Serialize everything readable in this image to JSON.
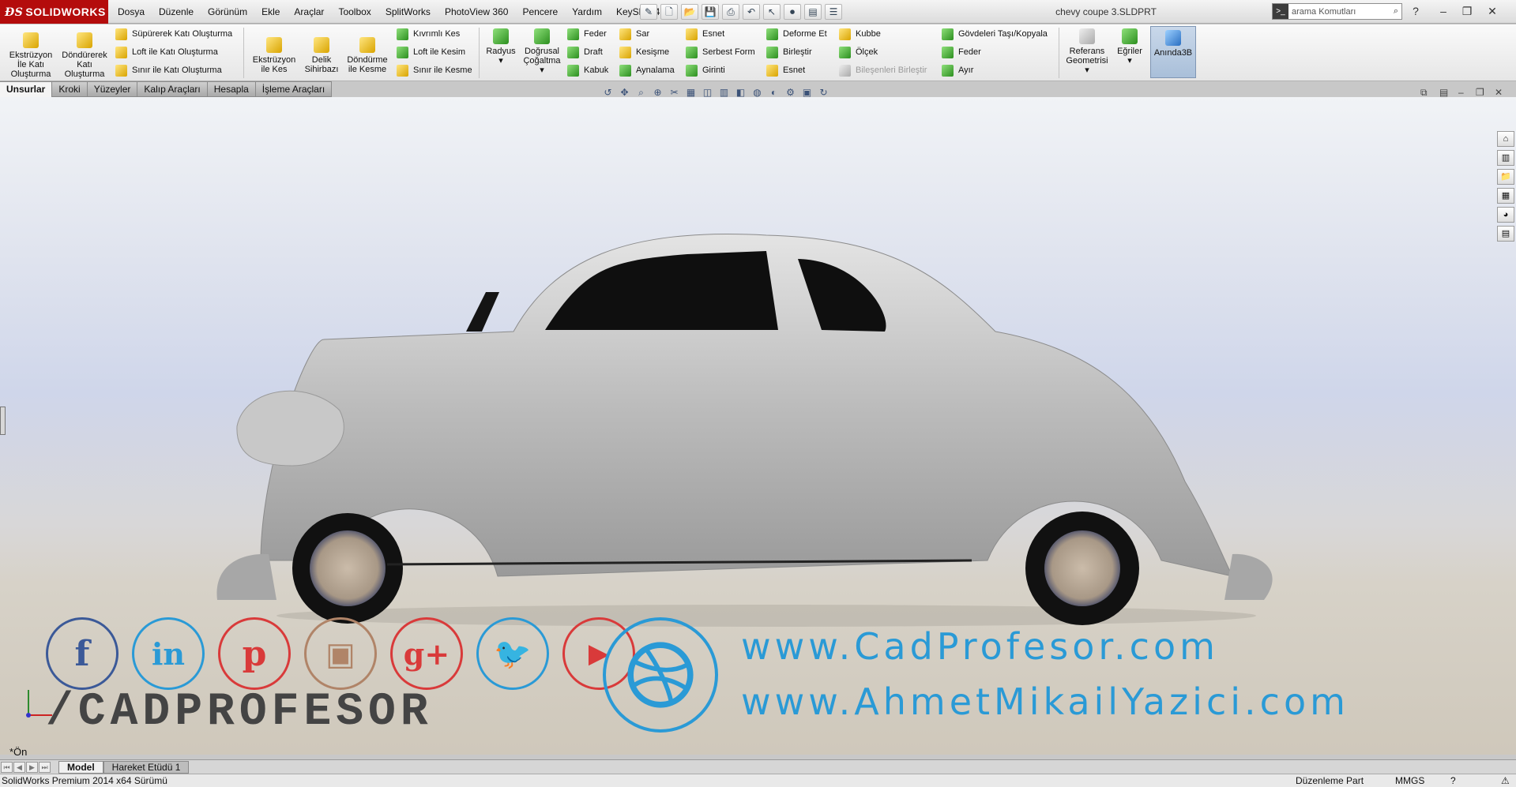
{
  "app": {
    "brand": "SOLIDWORKS",
    "doc_title": "chevy coupe 3.SLDPRT"
  },
  "menu": [
    "Dosya",
    "Düzenle",
    "Görünüm",
    "Ekle",
    "Araçlar",
    "Toolbox",
    "SplitWorks",
    "PhotoView 360",
    "Pencere",
    "Yardım",
    "KeyShot 4"
  ],
  "search": {
    "placeholder": "arama Komutları"
  },
  "ribbon": {
    "ekstruzyon": "Ekstrüzyon İle Katı Oluşturma",
    "dondurerek": "Döndürerek Katı Oluşturma",
    "supurerek": "Süpürerek Katı Oluşturma",
    "loft": "Loft ile Katı Oluşturma",
    "sinir": "Sınır ile Katı Oluşturma",
    "ekstruzyon_kes": "Ekstrüzyon ile Kes",
    "delik": "Delik Sihirbazı",
    "dondurme_kes": "Döndürme ile Kesme",
    "kivrimli": "Kıvrımlı Kes",
    "loft_kesim": "Loft ile Kesim",
    "sinir_kesme": "Sınır ile Kesme",
    "radyus": "Radyus",
    "dogrusal": "Doğrusal Çoğaltma",
    "feder": "Feder",
    "draft": "Draft",
    "kabuk": "Kabuk",
    "sar": "Sar",
    "kesisme": "Kesişme",
    "aynalama": "Aynalama",
    "esnet": "Esnet",
    "serbest_form": "Serbest Form",
    "girinti": "Girinti",
    "deforme": "Deforme Et",
    "birlestir": "Birleştir",
    "esnet2": "Esnet",
    "kubbe": "Kubbe",
    "olcek": "Ölçek",
    "bilesenleri": "Bileşenleri Birleştir",
    "govdeleri": "Gövdeleri Taşı/Kopyala",
    "feder2": "Feder",
    "ayir": "Ayır",
    "referans": "Referans Geometrisi",
    "egriler": "Eğriler",
    "aninda": "Anında3B"
  },
  "tabs": [
    "Unsurlar",
    "Kroki",
    "Yüzeyler",
    "Kalıp Araçları",
    "Hesapla",
    "İşleme Araçları"
  ],
  "watermark": {
    "brand": "/CADPROFESOR",
    "site1": "www.CadProfesor.com",
    "site2": "www.AhmetMikailYazici.com"
  },
  "view_name": "*Ön",
  "bottom_tabs": [
    "Model",
    "Hareket Etüdü 1"
  ],
  "status": {
    "version": "SolidWorks Premium 2014 x64 Sürümü",
    "mode": "Düzenleme Part",
    "units": "MMGS"
  },
  "colors": {
    "logo_red": "#b40c0c",
    "social_facebook": "#3b5998",
    "social_linkedin": "#2a9ad6",
    "social_pinterest": "#d93a3a",
    "social_instagram": "#b08468",
    "social_google": "#d93a3a",
    "social_twitter": "#2a9ad6",
    "social_youtube": "#d93a3a"
  }
}
